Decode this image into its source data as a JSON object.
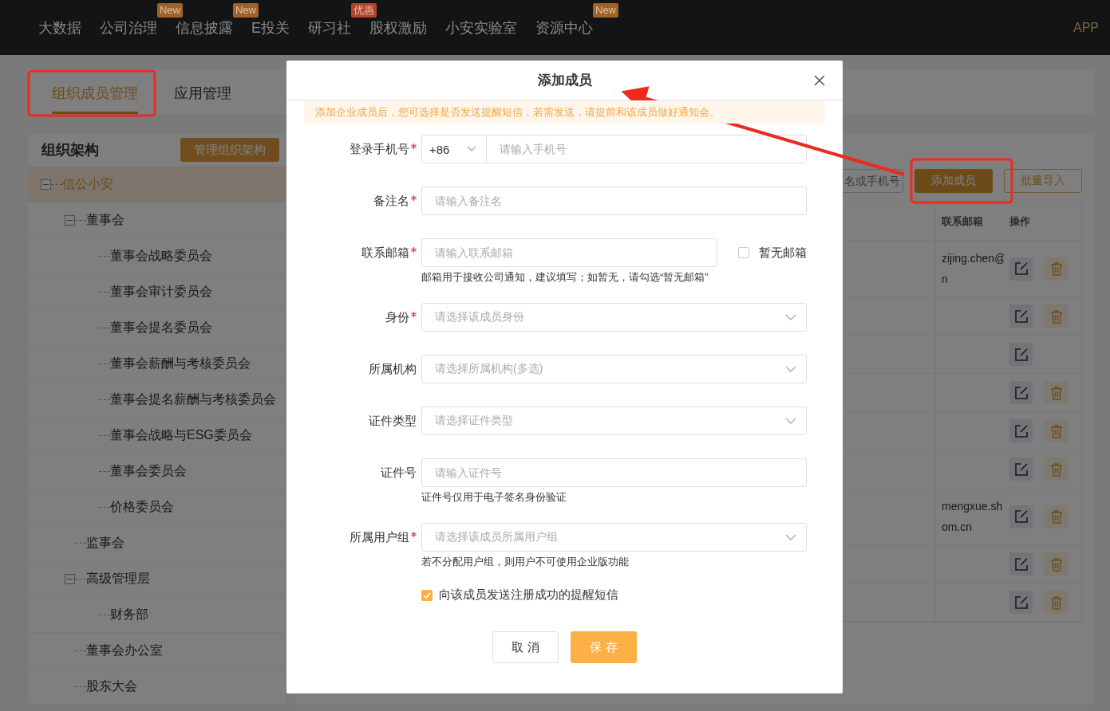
{
  "nav": {
    "items": [
      {
        "label": "大数据"
      },
      {
        "label": "公司治理",
        "badge": "New",
        "color": "#a0622a"
      },
      {
        "label": "信息披露",
        "badge": "New",
        "color": "#a0622a"
      },
      {
        "label": "E投关"
      },
      {
        "label": "研习社",
        "badge": "优惠",
        "color": "#b5432c"
      },
      {
        "label": "股权激励"
      },
      {
        "label": "小安实验室"
      },
      {
        "label": "资源中心",
        "badge": "New",
        "color": "#a0622a"
      }
    ],
    "right": "APP"
  },
  "tabs": [
    {
      "label": "组织成员管理",
      "selected": true
    },
    {
      "label": "应用管理",
      "selected": false
    }
  ],
  "org": {
    "title": "组织架构",
    "button": "管理组织架构",
    "tree": [
      {
        "label": "信公小安",
        "selected": true,
        "expanded": true,
        "children": [
          {
            "label": "董事会",
            "selected": false,
            "expanded": true,
            "children": [
              {
                "label": "董事会战略委员会",
                "selected": false
              },
              {
                "label": "董事会审计委员会",
                "selected": false
              },
              {
                "label": "董事会提名委员会",
                "selected": false
              },
              {
                "label": "董事会薪酬与考核委员会",
                "selected": false
              },
              {
                "label": "董事会提名薪酬与考核委员会",
                "selected": false
              },
              {
                "label": "董事会战略与ESG委员会",
                "selected": false
              },
              {
                "label": "董事会委员会",
                "selected": false
              },
              {
                "label": "价格委员会",
                "selected": false
              }
            ]
          },
          {
            "label": "监事会",
            "selected": false
          },
          {
            "label": "高级管理层",
            "selected": false,
            "expanded": true,
            "children": [
              {
                "label": "财务部",
                "selected": false
              }
            ]
          },
          {
            "label": "董事会办公室",
            "selected": false
          },
          {
            "label": "股东大会",
            "selected": false
          }
        ]
      }
    ]
  },
  "members": {
    "search": {
      "placeholder": "名或手机号"
    },
    "buttons": [
      {
        "label": "添加成员",
        "kind": "primary"
      },
      {
        "label": "批量导入",
        "kind": "outline"
      }
    ],
    "columns": [
      "联系邮箱",
      "操作"
    ],
    "rows": [
      {
        "email": "zijing.chen@\nn",
        "deletable": true
      },
      {
        "deletable": true
      },
      {
        "deletable": false
      },
      {
        "deletable": true
      },
      {
        "deletable": true
      },
      {
        "deletable": true
      },
      {
        "email": "mengxue.sh\nom.cn",
        "deletable": true
      },
      {
        "deletable": true
      },
      {
        "deletable": true
      }
    ]
  },
  "dialog": {
    "title": "添加成员",
    "notice": "添加企业成员后，您可选择是否发送提醒短信，若需发送，请提前和该成员做好通知会。",
    "fields": [
      {
        "kind": "phone",
        "label": "登录手机号",
        "required": true,
        "code": "+86",
        "placeholder": "请输入手机号"
      },
      {
        "kind": "text",
        "label": "备注名",
        "required": true,
        "placeholder": "请输入备注名"
      },
      {
        "kind": "email",
        "label": "联系邮箱",
        "required": true,
        "placeholder": "请输入联系邮箱",
        "option": {
          "label": "暂无邮箱",
          "checked": false
        },
        "hint": "邮箱用于接收公司通知，建议填写；如暂无，请勾选“暂无邮箱”"
      },
      {
        "kind": "select",
        "label": "身份",
        "required": true,
        "placeholder": "请选择该成员身份"
      },
      {
        "kind": "select",
        "label": "所属机构",
        "required": false,
        "placeholder": "请选择所属机构(多选)"
      },
      {
        "kind": "select",
        "label": "证件类型",
        "required": false,
        "placeholder": "请选择证件类型"
      },
      {
        "kind": "text",
        "label": "证件号",
        "required": false,
        "placeholder": "请输入证件号",
        "hint": "证件号仅用于电子签名身份验证"
      },
      {
        "kind": "select",
        "label": "所属用户组",
        "required": true,
        "placeholder": "请选择该成员所属用户组",
        "hint": "若不分配用户组，则用户不可使用企业版功能"
      }
    ],
    "sms": {
      "label": "向该成员发送注册成功的提醒短信",
      "checked": true
    },
    "buttons": [
      {
        "label": "取 消",
        "kind": "default"
      },
      {
        "label": "保 存",
        "kind": "primary"
      }
    ]
  }
}
